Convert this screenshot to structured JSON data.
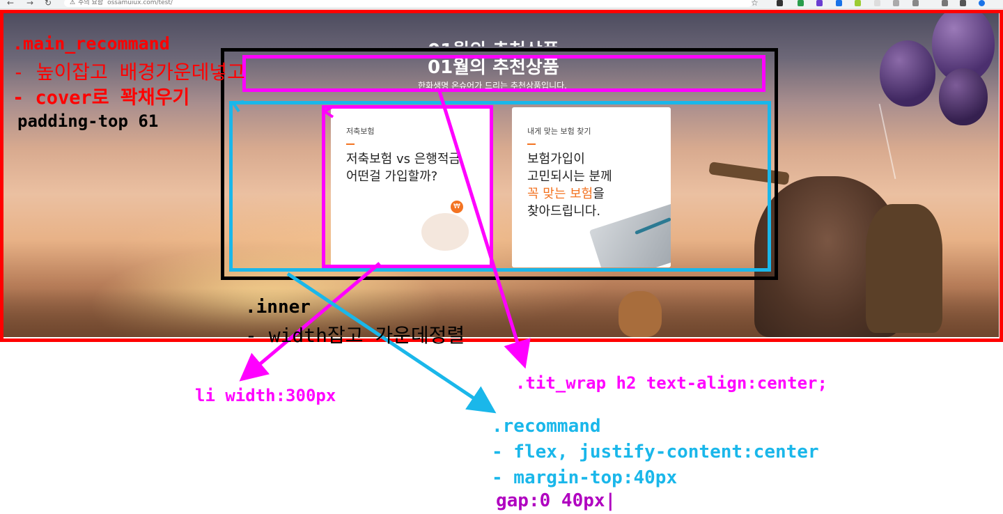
{
  "browser": {
    "warning_label": "주의 요함",
    "url": "ossamuiux.com/test/"
  },
  "hero": {
    "title": "01월의 추천상품",
    "subtitle": "한화생명 온슈어가 드리는 추천상품입니다."
  },
  "cards": [
    {
      "label": "저축보험",
      "text": "저축보험 vs 은행적금\n어떤걸 가입할까?"
    },
    {
      "label": "내게 맞는 보험 찾기",
      "text_before": "보험가입이\n고민되시는 분께\n",
      "highlight": "꼭 맞는 보험",
      "text_after": "을\n찾아드립니다."
    }
  ],
  "annotations": {
    "main_class": ".main_recommand",
    "main_note1": "- 높이잡고 배경가운데넣고",
    "main_note2": "- cover로 꽉채우기",
    "padding_note": "padding-top 61",
    "inner_class": ".inner",
    "inner_note": "- width잡고 가운데정렬",
    "li_note": "li width:300px",
    "tit_note": ".tit_wrap h2 text-align:center;",
    "recommand_class": ".recommand",
    "recommand_note1": "- flex, justify-content:center",
    "recommand_note2": "- margin-top:40px",
    "gap_note": "gap:0 40px|"
  },
  "colors": {
    "red": "#ff0000",
    "magenta": "#ff00ff",
    "cyan": "#1ab7ea",
    "accent": "#f37321"
  }
}
